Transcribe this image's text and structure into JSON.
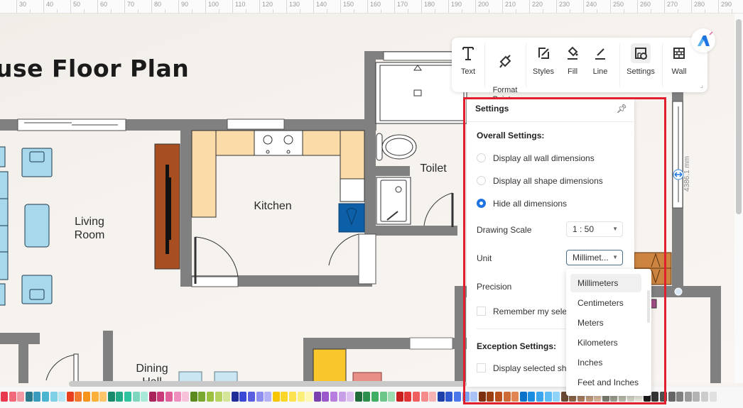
{
  "ruler": {
    "ticks": [
      "30",
      "40",
      "50",
      "60",
      "70",
      "80",
      "90",
      "100",
      "110",
      "120",
      "130",
      "140",
      "150",
      "160",
      "170",
      "180",
      "190",
      "200",
      "210",
      "220",
      "230",
      "240",
      "250",
      "260",
      "270",
      "280",
      "290"
    ]
  },
  "canvas": {
    "title": "use Floor Plan",
    "rooms": {
      "living": "Living\nRoom",
      "kitchen": "Kitchen",
      "toilet": "Toilet",
      "dining": "Dining\nHall"
    },
    "dimension_label": "4386.1 mm"
  },
  "toolbar": {
    "items": [
      {
        "label": "Text",
        "icon": "text-icon"
      },
      {
        "label": "Format\nPainter",
        "icon": "format-painter-icon"
      },
      {
        "label": "Styles",
        "icon": "styles-icon"
      },
      {
        "label": "Fill",
        "icon": "fill-icon"
      },
      {
        "label": "Line",
        "icon": "line-icon"
      },
      {
        "label": "Settings",
        "icon": "settings-icon"
      },
      {
        "label": "Wall",
        "icon": "wall-icon"
      }
    ]
  },
  "settings_panel": {
    "title": "Settings",
    "overall_heading": "Overall Settings:",
    "options": [
      {
        "label": "Display all wall dimensions",
        "selected": false
      },
      {
        "label": "Display all shape dimensions",
        "selected": false
      },
      {
        "label": "Hide all dimensions",
        "selected": true
      }
    ],
    "drawing_scale_label": "Drawing Scale",
    "drawing_scale_value": "1 : 50",
    "unit_label": "Unit",
    "unit_value": "Millimet...",
    "precision_label": "Precision",
    "remember_label": "Remember my sele",
    "exception_heading": "Exception Settings:",
    "display_selected_label": "Display selected sha"
  },
  "unit_dropdown": {
    "options": [
      "Millimeters",
      "Centimeters",
      "Meters",
      "Kilometers",
      "Inches",
      "Feet and Inches"
    ],
    "highlighted": "Millimeters"
  },
  "accent_color": "#1e74e0",
  "highlight_color": "#e0202c",
  "palette": [
    "#e8394f",
    "#f06a7a",
    "#f29aa4",
    "#2a7a8c",
    "#3a9bbf",
    "#4ab5cf",
    "#7dd0e5",
    "#b8e6f2",
    "#e8401c",
    "#f27a2e",
    "#f7941d",
    "#fbb03b",
    "#fdc56b",
    "#1a8a6c",
    "#22a985",
    "#2fc3a0",
    "#7fd6be",
    "#a7ead8",
    "#a8245a",
    "#c93a79",
    "#e0609a",
    "#ef8fbd",
    "#f6c1d9",
    "#5c8a1f",
    "#79a830",
    "#9bbf3e",
    "#b7d35f",
    "#d4e59a",
    "#1f2d99",
    "#3a48d6",
    "#5a5fe0",
    "#8e8ef0",
    "#b3b3f5",
    "#f7c600",
    "#fbd72b",
    "#fde24f",
    "#fbef7a",
    "#fdf7b3",
    "#7b3fae",
    "#9b58cc",
    "#b77ddf",
    "#c9a0e8",
    "#dcc1f0",
    "#1f6b3a",
    "#2d8f4e",
    "#3fae64",
    "#6cc68a",
    "#9bdcb0",
    "#c81e1e",
    "#e23636",
    "#ef5f5f",
    "#f48a8a",
    "#f7b3b3",
    "#1e3fa8",
    "#2f58d0",
    "#4a78ea",
    "#7aa0f2",
    "#a9c3f7",
    "#7a3010",
    "#9a3e14",
    "#b8501e",
    "#cd6a36",
    "#e08553",
    "#0b72c9",
    "#1b8de0",
    "#3aa5ec",
    "#5cbcf3",
    "#8fd3f8",
    "#6a4a33",
    "#8a6448",
    "#a57c5e",
    "#c09a7c",
    "#d7b79c",
    "#7d7d70",
    "#9c9c8e",
    "#b9b9ab",
    "#d2d2c6",
    "#e6e6dc",
    "#1a1a1a",
    "#333333",
    "#4d4d4d",
    "#666666",
    "#808080",
    "#9a9a9a",
    "#b3b3b3",
    "#cccccc",
    "#e0e0e0"
  ]
}
